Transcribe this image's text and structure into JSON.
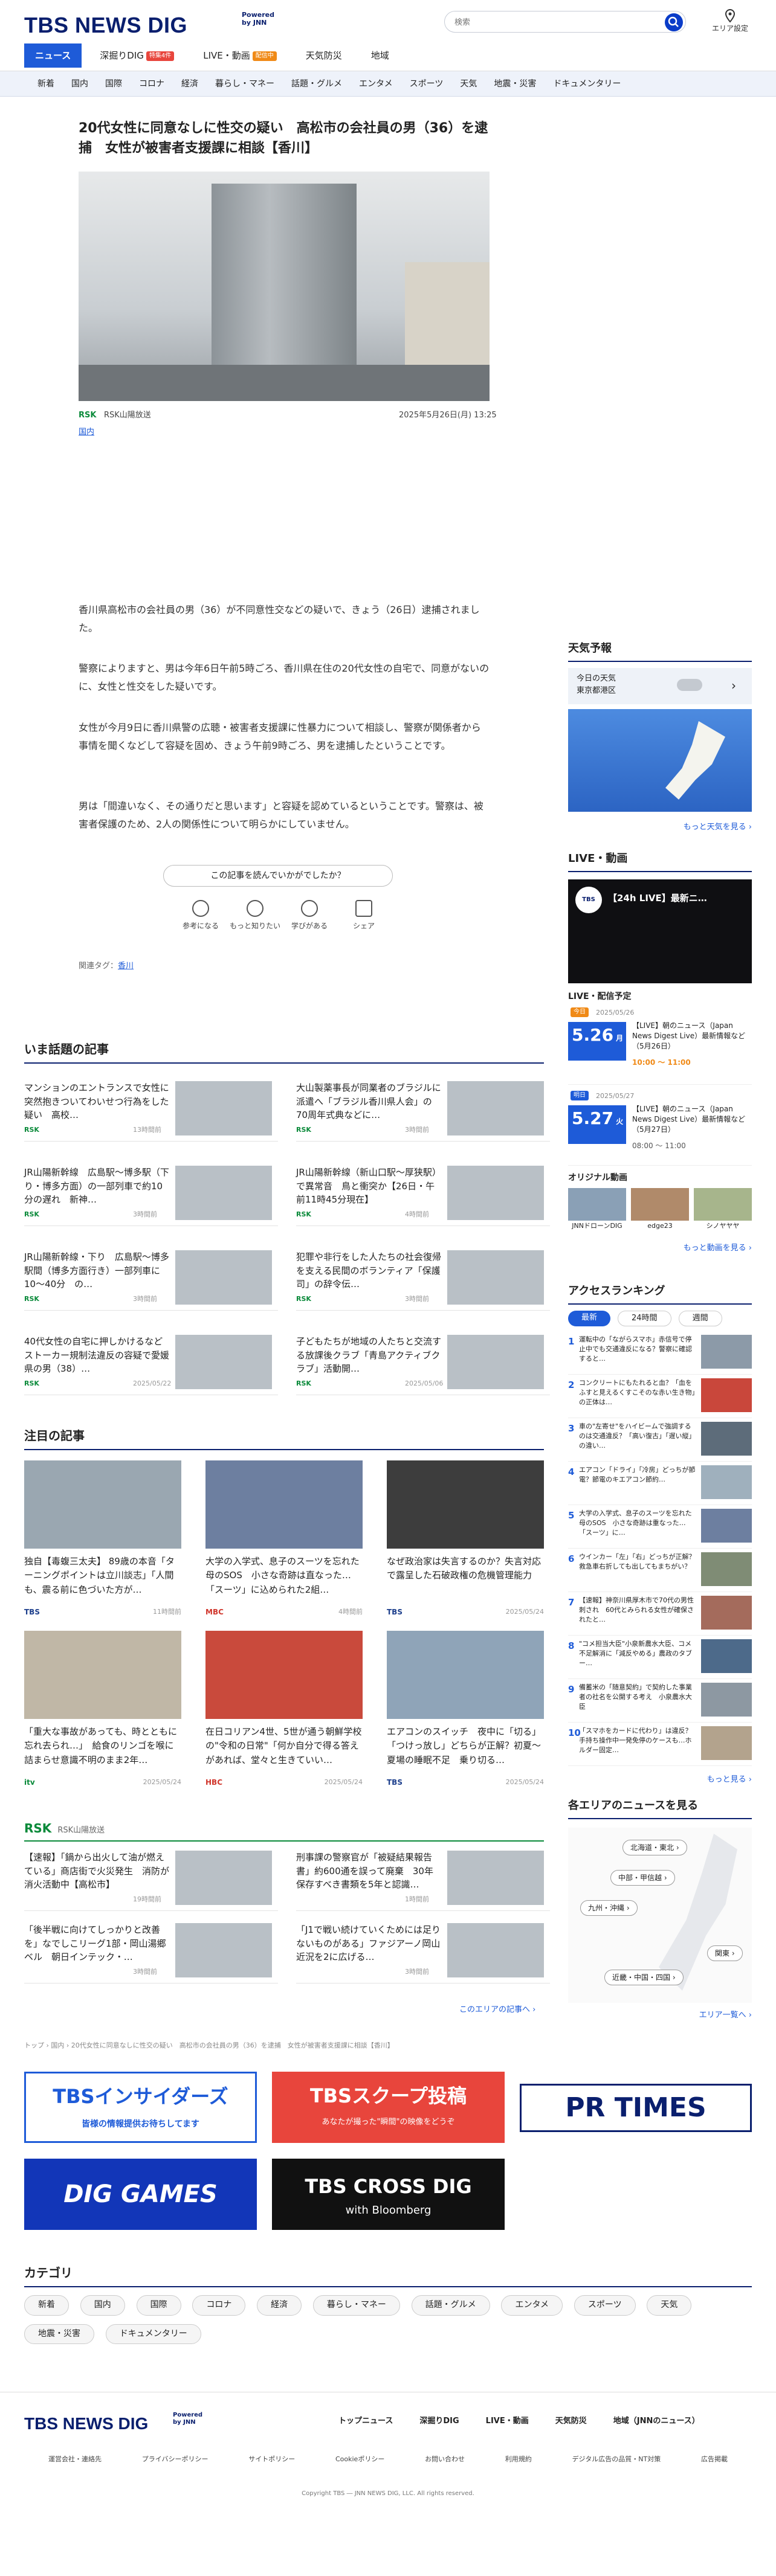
{
  "header": {
    "logo_text": "TBS NEWS DIG",
    "logo_powered": "Powered by JNN",
    "search_placeholder": "検索",
    "area_label": "エリア設定",
    "tabs": [
      {
        "label": "ニュース"
      },
      {
        "label": "深掘りDIG",
        "badge": "特集4件"
      },
      {
        "label": "LIVE・動画",
        "badge": "配信中"
      },
      {
        "label": "天気防災"
      },
      {
        "label": "地域"
      }
    ],
    "categories": [
      "新着",
      "国内",
      "国際",
      "コロナ",
      "経済",
      "暮らし・マネー",
      "話題・グルメ",
      "エンタメ",
      "スポーツ",
      "天気",
      "地震・災害",
      "ドキュメンタリー"
    ]
  },
  "article": {
    "title": "20代女性に同意なしに性交の疑い　高松市の会社員の男（36）を逮捕　女性が被害者支援課に相談【香川】",
    "source": "RSK山陽放送",
    "date": "2025年5月26日(月) 13:25",
    "category": "国内",
    "paragraphs": [
      "香川県高松市の会社員の男（36）が不同意性交などの疑いで、きょう（26日）逮捕されました。",
      "警察によりますと、男は今年6日午前5時ごろ、香川県在住の20代女性の自宅で、同意がないのに、女性と性交をした疑いです。",
      "女性が今月9日に香川県警の広聴・被害者支援課に性暴力について相談し、警察が関係者から事情を聞くなどして容疑を固め、きょう午前9時ごろ、男を逮捕したということです。",
      "男は「間違いなく、その通りだと思います」と容疑を認めているということです。警察は、被害者保護のため、2人の関係性について明らかにしていません。"
    ],
    "question": "この記事を読んでいかがでしたか？",
    "reactions": [
      "参考になる",
      "もっと知りたい",
      "学びがある",
      "シェア"
    ],
    "tags_label": "関連タグ：",
    "tag": "香川"
  },
  "trending": {
    "title": "いま話題の記事",
    "items": [
      {
        "title": "マンションのエントランスで女性に突然抱きついてわいせつ行為をした疑い　高校…",
        "src": "RSK",
        "date": "13時間前"
      },
      {
        "title": "大山製薬事長が同業者のブラジルに派遣へ「ブラジル香川県人会」の70周年式典などに…",
        "src": "RSK",
        "date": "3時間前"
      },
      {
        "title": "JR山陽新幹線　広島駅〜博多駅（下り・博多方面）の一部列車で約10分の遅れ　新神…",
        "src": "RSK",
        "date": "3時間前"
      },
      {
        "title": "JR山陽新幹線（新山口駅〜厚狭駅）で異常音　鳥と衝突か【26日・午前11時45分現在】",
        "src": "RSK",
        "date": "4時間前"
      },
      {
        "title": "JR山陽新幹線・下り　広島駅〜博多駅間（博多方面行き）一部列車に10〜40分　の…",
        "src": "RSK",
        "date": "3時間前"
      },
      {
        "title": "犯罪や非行をした人たちの社会復帰を支える民間のボランティア「保護司」の辞令伝…",
        "src": "RSK",
        "date": "3時間前"
      },
      {
        "title": "40代女性の自宅に押しかけるなど　ストーカー規制法違反の容疑で愛媛県の男（38）…",
        "src": "RSK",
        "date": "2025/05/22"
      },
      {
        "title": "子どもたちが地域の人たちと交流する放課後クラブ「青島アクティブクラブ」活動開…",
        "src": "RSK",
        "date": "2025/05/06"
      }
    ]
  },
  "featured": {
    "title": "注目の記事",
    "items": [
      {
        "title": "独自【毒蝮三太夫】 89歳の本音「ターニングポイントは立川談志」「人間も、震る前に色づいた方が…",
        "src": "TBS",
        "date": "11時間前"
      },
      {
        "title": "大学の入学式、息子のスーツを忘れた母のSOS　小さな奇跡は直なった…「スーツ」に込められた2組…",
        "src": "MBC",
        "date": "4時間前"
      },
      {
        "title": "なぜ政治家は失言するのか？失言対応で露呈した石破政権の危機管理能力",
        "src": "TBS",
        "date": "2025/05/24"
      },
      {
        "title": "「重大な事故があっても、時とともに忘れ去られ…」　給食のリンゴを喉に詰まらせ意識不明のまま2年…",
        "src": "itv",
        "date": "2025/05/24"
      },
      {
        "title": "在日コリアン4世、5世が通う朝鮮学校の\"令和の日常\"「何か自分で得る答えがあれば、堂々と生きていい…",
        "src": "HBC",
        "date": "2025/05/24"
      },
      {
        "title": "エアコンのスイッチ　夜中に「切る」「つけっ放し」どちらが正解？初夏〜夏場の睡眠不足　乗り切る…",
        "src": "TBS",
        "date": "2025/05/24"
      }
    ]
  },
  "local": {
    "label": "RSK山陽放送",
    "items": [
      {
        "title": "【速報】「鍋から出火して油が燃えている」商店街で火災発生　消防が消火活動中【高松市】",
        "src": "RSK",
        "date": "19時間前"
      },
      {
        "title": "刑事課の警察官が「被疑結果報告書」約600通を誤って廃棄　30年保存すべき書類を5年と認識…",
        "src": "RSK",
        "date": "1時間前"
      },
      {
        "title": "「後半戦に向けてしっかりと改善を」なでしこリーグ1部・岡山湯郷ベル　朝日インテック・…",
        "src": "RSK",
        "date": "3時間前"
      },
      {
        "title": "「J1で戦い続けていくためには足りないものがある」ファジアーノ岡山　近況を2に広げる…",
        "src": "RSK",
        "date": "3時間前"
      }
    ],
    "more": "このエリアの記事へ ›"
  },
  "breadcrumb": "トップ › 国内 › 20代女性に同意なしに性交の疑い　高松市の会社員の男（36）を逮捕　女性が被害者支援課に相談【香川】",
  "banners": {
    "insiders": "TBSインサイダーズ",
    "insiders_sub": "皆様の情報提供お待ちしてます",
    "scoop": "TBSスクープ投稿",
    "scoop_sub": "あなたが撮った\"瞬間\"の映像をどうぞ",
    "prtimes": "PR TIMES",
    "games": "DIG GAMES",
    "crossdig": "TBS CROSS DIG",
    "crossdig_sub": "with Bloomberg"
  },
  "bottom_categories": {
    "title": "カテゴリ",
    "items": [
      "新着",
      "国内",
      "国際",
      "コロナ",
      "経済",
      "暮らし・マネー",
      "話題・グルメ",
      "エンタメ",
      "スポーツ",
      "天気",
      "地震・災害",
      "ドキュメンタリー"
    ]
  },
  "sidebar": {
    "weather_title": "天気予報",
    "weather_city_line1": "今日の天気",
    "weather_city_line2": "東京都港区",
    "weather_more": "もっと天気を見る ›",
    "live_title": "LIVE・動画",
    "live_video_title": "【24h LIVE】最新ニ…",
    "schedule_title": "LIVE・配信予定",
    "schedule": [
      {
        "date": "5.26",
        "weekday": "月",
        "label": "今日",
        "date_full": "2025/05/26",
        "title": "【LIVE】朝のニュース（Japan News Digest Live）最新情報など（5月26日）",
        "time": "10:00 〜 11:00"
      },
      {
        "date": "5.27",
        "weekday": "火",
        "label": "明日",
        "date_full": "2025/05/27",
        "title": "【LIVE】朝のニュース（Japan News Digest Live）最新情報など（5月27日）",
        "time": "08:00 〜 11:00"
      }
    ],
    "original_title": "オリジナル動画",
    "originals": [
      "JNNドローンDIG",
      "edge23",
      "シノヤヤヤ"
    ],
    "live_more": "もっと動画を見る ›",
    "ranking_title": "アクセスランキング",
    "ranking_tabs": [
      "最新",
      "24時間",
      "週間"
    ],
    "ranking": [
      "運転中の「ながらスマホ」赤信号で停止中でも交通違反になる？警察に確認すると…",
      "コンクリートにもたれると血？「血をふすと見えるくすこそのな赤い生き物」の正体は…",
      "車の\"左寄せ\"をハイビームで強調するのは交通違反？「高い復古」「遅い縦」の違い…",
      "エアコン「ドライ」「冷房」どっちが節電？節電のキエアコン節約…",
      "大学の入学式、息子のスーツを忘れた母のSOS　小さな奇跡は重なった…「スーツ」に…",
      "ウインカー「左」「右」どっちが正解？救急車右折しても出してもまちがい？",
      "【速報】神奈川県厚木市で70代の男性刺され　60代とみられる女性が確保されたと…",
      "\"コメ担当大臣\"小泉新農水大臣、コメ不足解消に「減反やめる」農政のタブー…",
      "備蓄米の「随意契約」で契約した事業者の社名を公開する考え　小泉農水大臣",
      "「スマホをカードに代わり」は違反？手持ち操作中一発免停のケースも…ホルダー固定…"
    ],
    "ranking_more": "もっと見る ›",
    "area_title": "各エリアのニュースを見る",
    "areas": [
      "北海道・東北 ›",
      "中部・甲信越 ›",
      "九州・沖縄 ›",
      "関東 ›",
      "近畿・中国・四国 ›"
    ],
    "area_more": "エリア一覧へ ›"
  },
  "footer": {
    "logo_text": "TBS NEWS DIG",
    "logo_powered": "Powered by JNN",
    "nav": [
      "トップニュース",
      "深掘りDIG",
      "LIVE・動画",
      "天気防災",
      "地域（JNNのニュース）"
    ],
    "links": [
      "運営会社・連絡先",
      "プライバシーポリシー",
      "サイトポリシー",
      "Cookieポリシー",
      "お問い合わせ",
      "利用規約",
      "デジタル広告の品質・NT対策",
      "広告掲載"
    ],
    "copyright": "Copyright TBS ― JNN NEWS DIG, LLC. All rights reserved."
  },
  "colors": {
    "brand": "#0a1f6e",
    "accent": "#1e5bd8",
    "rsk_green": "#0a8a3a",
    "live_red": "#e8453c"
  }
}
